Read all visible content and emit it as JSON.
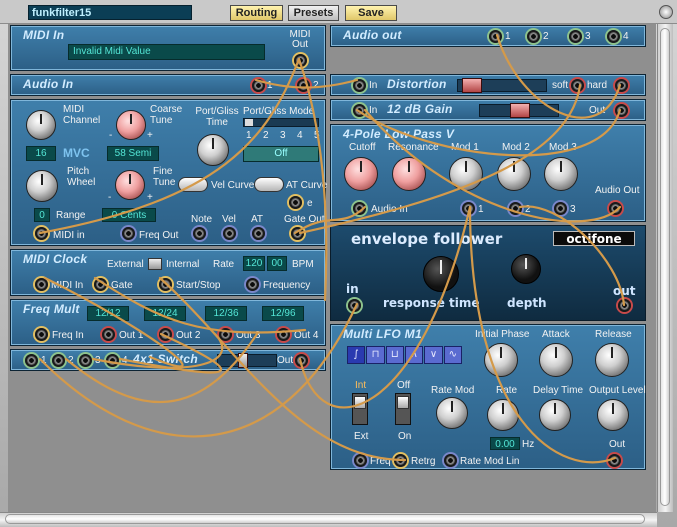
{
  "header": {
    "patch_name": "funkfilter15",
    "routing_label": "Routing",
    "presets_label": "Presets",
    "save_label": "Save"
  },
  "midi_in": {
    "title": "MIDI In",
    "display": "Invalid Midi Value",
    "midi_out_label": "MIDI Out"
  },
  "audio_in": {
    "title": "Audio In",
    "j1": "1",
    "j2": "2"
  },
  "midi_converter": {
    "midi_channel_label": "MIDI Channel",
    "midi_channel_value": "16",
    "mvc_label": "MVC",
    "coarse_tune_label": "Coarse Tune",
    "coarse_tune_value": "58 Semi",
    "coarse_minus": "-",
    "coarse_plus": "+",
    "port_gliss_time_label": "Port/Gliss Time",
    "port_gliss_mode_label": "Port/Gliss Mode",
    "mode_nums": [
      "1",
      "2",
      "3",
      "4",
      "5"
    ],
    "mode_value": "Off",
    "pitch_wheel_label": "Pitch Wheel",
    "fine_tune_label": "Fine Tune",
    "fine_tune_value": "0 Cents",
    "fine_minus": "-",
    "fine_plus": "+",
    "range_label": "Range",
    "range_value": "0",
    "vel_curve_label": "Vel Curve",
    "at_curve_label": "AT Curve",
    "e_label": "e",
    "note_label": "Note",
    "vel_label": "Vel",
    "at_label": "AT",
    "gate_out_label": "Gate Out",
    "midi_in_label": "MIDI in",
    "freq_out_label": "Freq Out"
  },
  "midi_clock": {
    "title": "MIDI Clock",
    "external_label": "External",
    "internal_label": "Internal",
    "rate_label": "Rate",
    "bpm_value": "120",
    "bpm_frac": "00",
    "bpm_label": "BPM",
    "midi_in_label": "MIDI In",
    "gate_label": "Gate",
    "start_stop_label": "Start/Stop",
    "frequency_label": "Frequency"
  },
  "freq_mult": {
    "title": "Freq Mult",
    "ratios": [
      "12/12",
      "12/24",
      "12/36",
      "12/96"
    ],
    "freq_in_label": "Freq In",
    "outs": [
      "Out 1",
      "Out 2",
      "Out 3",
      "Out 4"
    ]
  },
  "switch": {
    "title": "4x1 Switch",
    "nums": [
      "1",
      "2",
      "3",
      "4"
    ],
    "out_label": "Out"
  },
  "audio_out": {
    "title": "Audio out",
    "nums": [
      "1",
      "2",
      "3",
      "4"
    ]
  },
  "distortion": {
    "title": "Distortion",
    "in_label": "In",
    "soft_label": "soft",
    "hard_label": "hard"
  },
  "gain": {
    "title": "12 dB Gain",
    "in_label": "In",
    "out_label": "Out"
  },
  "lowpass": {
    "title": "4-Pole Low Pass V",
    "cutoff_label": "Cutoff",
    "resonance_label": "Resonance",
    "mod1_label": "Mod 1",
    "mod2_label": "Mod 2",
    "mod3_label": "Mod 3",
    "audio_in_label": "Audio In",
    "audio_out_label": "Audio Out",
    "n1": "1",
    "n2": "2",
    "n3": "3"
  },
  "envelope": {
    "title": "envelope follower",
    "logo": "octifone",
    "response_label": "response time",
    "depth_label": "depth",
    "in_label": "in",
    "out_label": "out"
  },
  "lfo": {
    "title": "Multi LFO M1",
    "initial_phase_label": "Initial Phase",
    "attack_label": "Attack",
    "release_label": "Release",
    "int_label": "Int",
    "ext_label": "Ext",
    "off_label": "Off",
    "on_label": "On",
    "rate_mod_label": "Rate Mod",
    "rate_label": "Rate",
    "delay_time_label": "Delay Time",
    "output_level_label": "Output Level",
    "rate_value": "0.00",
    "hz_label": "Hz",
    "out_label": "Out",
    "freq_label": "Freq",
    "retrg_label": "Retrg",
    "rate_mod_lin_label": "Rate Mod Lin",
    "waves": [
      "∫",
      "⊓",
      "⊔",
      "∧",
      "∨",
      "∿"
    ]
  },
  "colors": {
    "panel": "#3472a0",
    "lcd_text": "#54e6d6",
    "cable": "#d49a4a",
    "jack_yellow": "#e2bf62",
    "jack_red": "#c84a4a"
  }
}
